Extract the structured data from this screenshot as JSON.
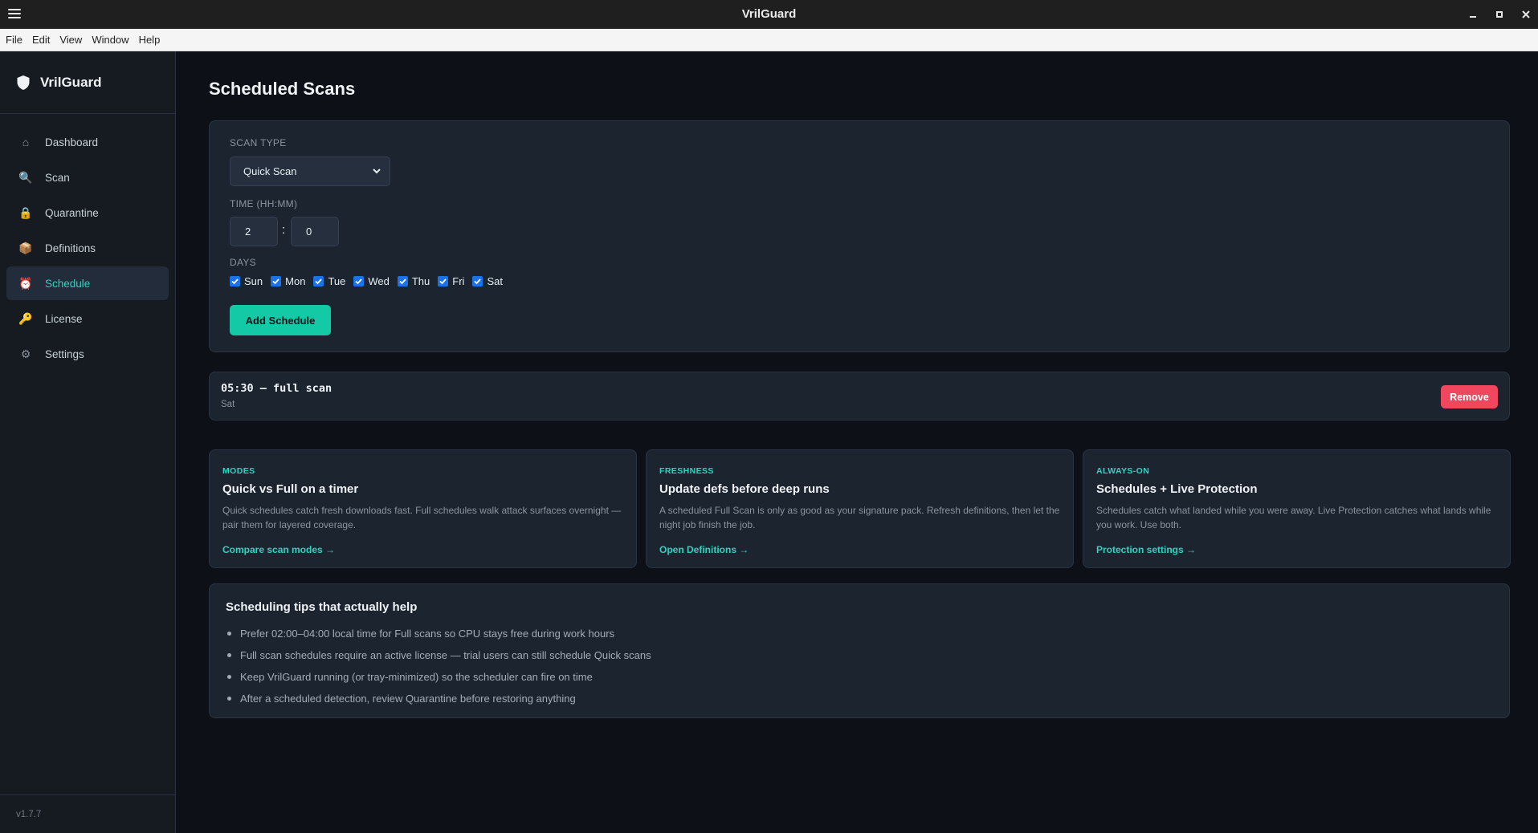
{
  "window": {
    "title": "VrilGuard"
  },
  "menu": [
    "File",
    "Edit",
    "View",
    "Window",
    "Help"
  ],
  "sidebar": {
    "brand": "VrilGuard",
    "items": [
      {
        "label": "Dashboard",
        "icon": "home-icon",
        "glyph": "⌂",
        "color": "#8b949e"
      },
      {
        "label": "Scan",
        "icon": "search-icon",
        "glyph": "🔍",
        "color": "#e6edf3"
      },
      {
        "label": "Quarantine",
        "icon": "lock-icon",
        "glyph": "🔒",
        "color": "#f2b134"
      },
      {
        "label": "Definitions",
        "icon": "package-icon",
        "glyph": "📦",
        "color": "#c9894a"
      },
      {
        "label": "Schedule",
        "icon": "alarm-clock-icon",
        "glyph": "⏰",
        "color": "#f0475e",
        "active": true
      },
      {
        "label": "License",
        "icon": "key-icon",
        "glyph": "🔑",
        "color": "#f2b134"
      },
      {
        "label": "Settings",
        "icon": "gear-icon",
        "glyph": "⚙",
        "color": "#8b949e"
      }
    ],
    "version": "v1.7.7"
  },
  "page": {
    "title": "Scheduled Scans"
  },
  "form": {
    "scan_type_label": "SCAN TYPE",
    "scan_type_value": "Quick Scan",
    "time_label": "TIME (HH:MM)",
    "hour": "2",
    "minute": "0",
    "days_label": "DAYS",
    "days": [
      {
        "label": "Sun",
        "checked": true
      },
      {
        "label": "Mon",
        "checked": true
      },
      {
        "label": "Tue",
        "checked": true
      },
      {
        "label": "Wed",
        "checked": true
      },
      {
        "label": "Thu",
        "checked": true
      },
      {
        "label": "Fri",
        "checked": true
      },
      {
        "label": "Sat",
        "checked": true
      }
    ],
    "add_label": "Add Schedule"
  },
  "schedules": [
    {
      "time": "05:30 — full scan",
      "days": "Sat",
      "remove_label": "Remove"
    }
  ],
  "cards": [
    {
      "kicker": "MODES",
      "title": "Quick vs Full on a timer",
      "body": "Quick schedules catch fresh downloads fast. Full schedules walk attack surfaces overnight — pair them for layered coverage.",
      "link": "Compare scan modes →"
    },
    {
      "kicker": "FRESHNESS",
      "title": "Update defs before deep runs",
      "body": "A scheduled Full Scan is only as good as your signature pack. Refresh definitions, then let the night job finish the job.",
      "link": "Open Definitions →"
    },
    {
      "kicker": "ALWAYS-ON",
      "title": "Schedules + Live Protection",
      "body": "Schedules catch what landed while you were away. Live Protection catches what lands while you work. Use both.",
      "link": "Protection settings →"
    }
  ],
  "tips": {
    "title": "Scheduling tips that actually help",
    "items": [
      "Prefer 02:00–04:00 local time for Full scans so CPU stays free during work hours",
      "Full scan schedules require an active license — trial users can still schedule Quick scans",
      "Keep VrilGuard running (or tray-minimized) so the scheduler can fire on time",
      "After a scheduled detection, review Quarantine before restoring anything"
    ]
  },
  "colors": {
    "accent": "#2dd4bf",
    "primary_button": "#14c9a5",
    "danger_button": "#f0475e",
    "checkbox": "#1a73e8",
    "background": "#0d1117",
    "panel": "#1c2430"
  }
}
